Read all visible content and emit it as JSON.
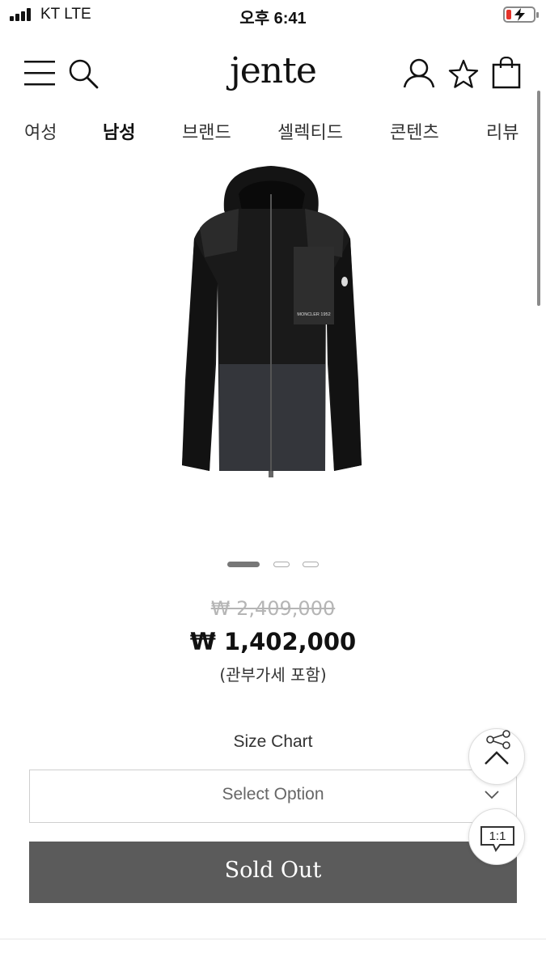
{
  "status_bar": {
    "carrier": "KT   LTE",
    "time": "오후 6:41"
  },
  "header": {
    "logo": "jente",
    "icons": [
      "menu-icon",
      "search-icon",
      "user-icon",
      "star-icon",
      "bag-icon"
    ]
  },
  "nav": {
    "items": [
      {
        "label": "여성"
      },
      {
        "label": "남성"
      },
      {
        "label": "브랜드"
      },
      {
        "label": "셀렉티드"
      },
      {
        "label": "콘텐츠"
      },
      {
        "label": "리뷰"
      }
    ],
    "active_index": 1
  },
  "product": {
    "image_label": "MONCLER 1952",
    "original_price": "₩ 2,409,000",
    "sale_price": "₩ 1,402,000",
    "price_note": "(관부가세 포함)"
  },
  "gallery": {
    "current_slide": 1,
    "total_slides": 3
  },
  "options": {
    "size_chart_label": "Size Chart",
    "select_placeholder": "Select Option",
    "sold_out_label": "Sold Out"
  },
  "floating": {
    "chat_label": "1:1"
  },
  "colors": {
    "sold_out_bg": "#5b5b5b",
    "strike_price": "#b5b5b5",
    "battery_low": "#e5332a"
  }
}
